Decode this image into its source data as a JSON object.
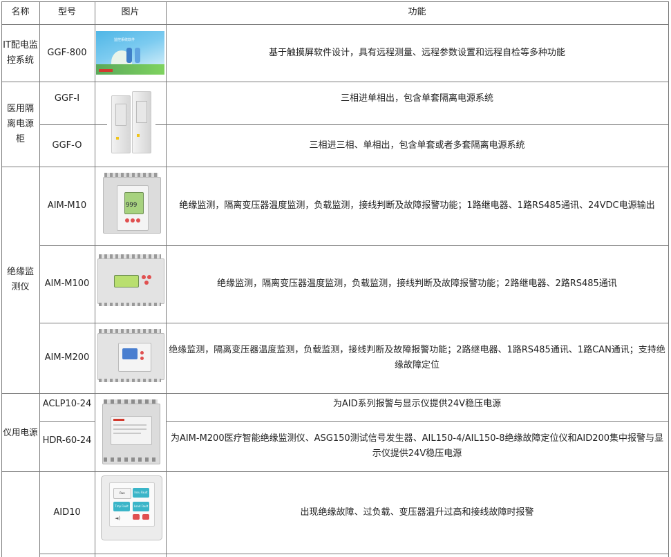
{
  "header": {
    "name": "名称",
    "model": "型号",
    "picture": "图片",
    "function": "功能"
  },
  "rows": [
    {
      "name": "IT配电监控系统",
      "model": "GGF-800",
      "function": "基于触摸屏软件设计，具有远程测量、远程参数设置和远程自检等多种功能"
    },
    {
      "name": "医用隔离电源柜",
      "model": "GGF-I",
      "function": "三相进单相出，包含单套隔离电源系统"
    },
    {
      "model": "GGF-O",
      "function": "三相进三相、单相出，包含单套或者多套隔离电源系统"
    },
    {
      "name": "绝缘监测仪",
      "model": "AIM-M10",
      "function": "绝缘监测，隔离变压器温度监测，负载监测，接线判断及故障报警功能；1路继电器、1路RS485通讯、24VDC电源输出"
    },
    {
      "model": "AIM-M100",
      "function": "绝缘监测，隔离变压器温度监测，负载监测，接线判断及故障报警功能；2路继电器、2路RS485通讯"
    },
    {
      "model": "AIM-M200",
      "function": "绝缘监测，隔离变压器温度监测，负载监测，接线判断及故障报警功能；2路继电器、1路RS485通讯、1路CAN通讯；支持绝缘故障定位"
    },
    {
      "name": "仪用电源",
      "model": "ACLP10-24",
      "function": "为AID系列报警与显示仪提供24V稳压电源"
    },
    {
      "model": "HDR-60-24",
      "function": "为AIM-M200医疗智能绝缘监测仪、ASG150测试信号发生器、AIL150-4/AIL150-8绝缘故障定位仪和AID200集中报警与显示仪提供24V稳压电源"
    },
    {
      "model": "AID10",
      "function": "出现绝缘故障、过负载、变压器温升过高和接线故障时报警"
    }
  ],
  "images": {
    "ggf800_title": "监控系统软件",
    "aim_m10_display": "999",
    "aid10_labels": [
      "Run",
      "Insu Fault",
      "Tmp Fault",
      "Load Fault"
    ]
  }
}
